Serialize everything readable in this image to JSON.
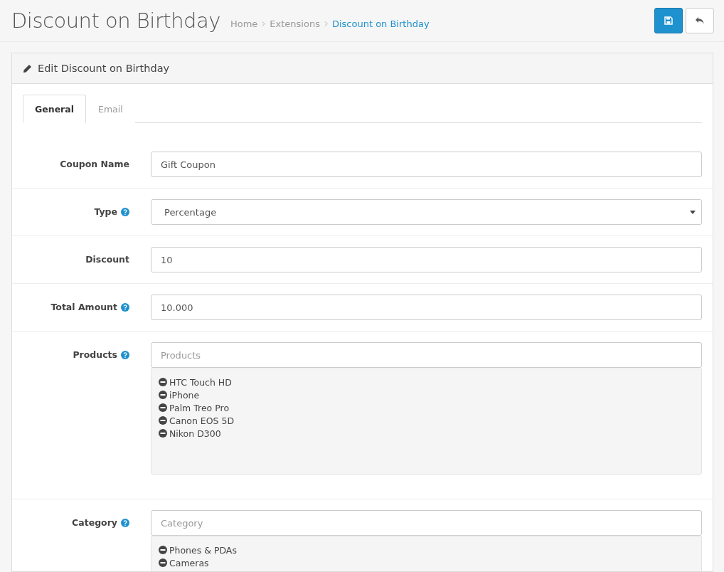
{
  "page": {
    "title": "Discount on Birthday",
    "breadcrumb": [
      {
        "label": "Home",
        "current": false
      },
      {
        "label": "Extensions",
        "current": false
      },
      {
        "label": "Discount on Birthday",
        "current": true
      }
    ]
  },
  "panel": {
    "title": "Edit Discount on Birthday"
  },
  "tabs": [
    {
      "label": "General",
      "selected": true
    },
    {
      "label": "Email",
      "selected": false
    }
  ],
  "fields": [
    {
      "kind": "text",
      "label": "Coupon Name",
      "help": false,
      "value": "Gift Coupon"
    },
    {
      "kind": "select",
      "label": "Type",
      "help": true,
      "value": "Percentage"
    },
    {
      "kind": "text",
      "label": "Discount",
      "help": false,
      "value": "10"
    },
    {
      "kind": "text",
      "label": "Total Amount",
      "help": true,
      "value": "10.000"
    },
    {
      "kind": "autocomplete",
      "label": "Products",
      "help": true,
      "placeholder": "Products",
      "items": [
        "HTC Touch HD",
        "iPhone",
        "Palm Treo Pro",
        "Canon EOS 5D",
        "Nikon D300"
      ]
    },
    {
      "kind": "autocomplete",
      "label": "Category",
      "help": true,
      "placeholder": "Category",
      "items": [
        "Phones & PDAs",
        "Cameras"
      ]
    }
  ]
}
